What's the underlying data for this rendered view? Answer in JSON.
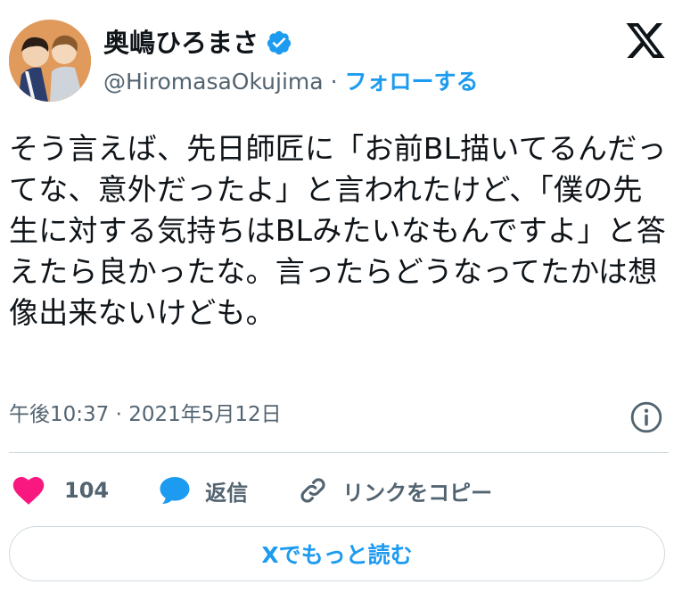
{
  "author": {
    "display_name": "奥嶋ひろまさ",
    "handle": "@HiromasaOkujima",
    "separator": "·",
    "follow_label": "フォローする",
    "verified": true
  },
  "tweet": {
    "text": "そう言えば、先日師匠に「お前BL描いてるんだってな、意外だったよ」と言われたけど、「僕の先生に対する気持ちはBLみたいなもんですよ」と答えたら良かったな。言ったらどうなってたかは想像出来ないけども。",
    "time": "午後10:37",
    "date_separator": "·",
    "date": "2021年5月12日"
  },
  "actions": {
    "like_count": "104",
    "reply_label": "返信",
    "copy_link_label": "リンクをコピー"
  },
  "read_more_label": "Xでもっと読む",
  "colors": {
    "accent": "#1d9bf0",
    "like": "#f91880",
    "muted": "#536471",
    "text": "#0f1419"
  },
  "icons": [
    "x-logo-icon",
    "verified-badge-icon",
    "info-icon",
    "heart-icon",
    "reply-bubble-icon",
    "link-icon"
  ]
}
